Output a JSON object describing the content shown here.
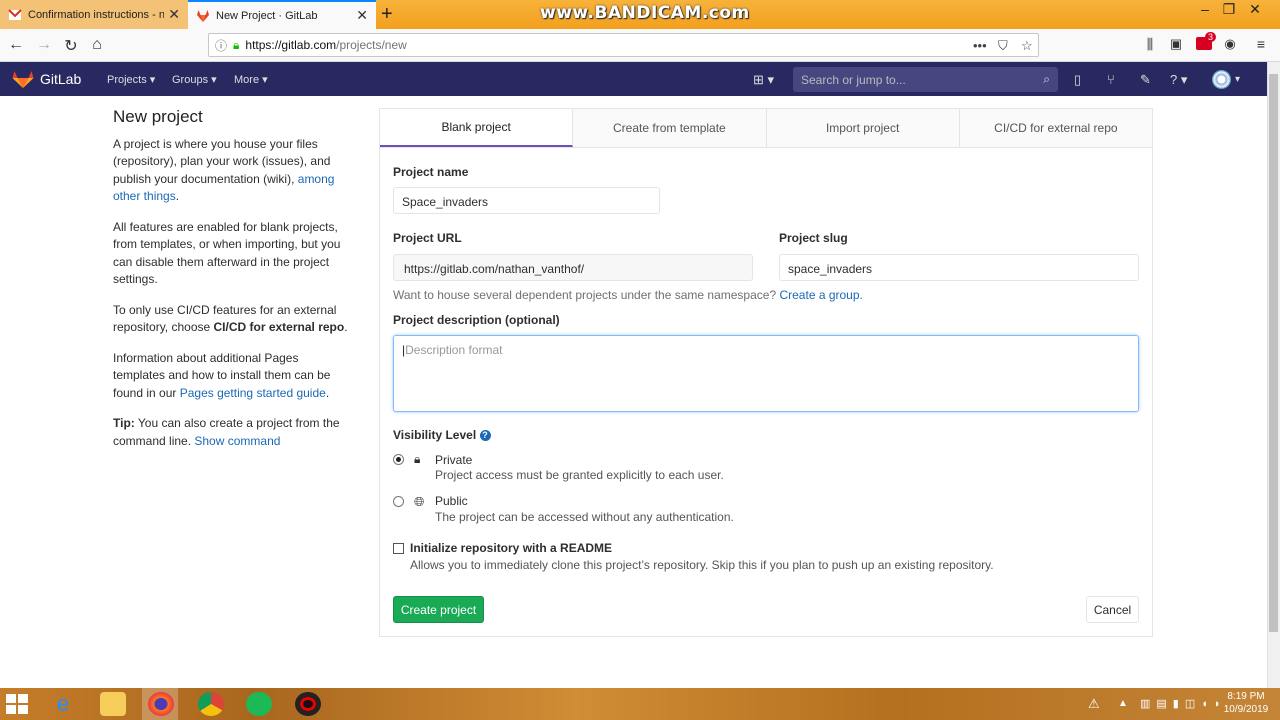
{
  "browser": {
    "tabs": [
      {
        "title": "Confirmation instructions - nat",
        "active": false,
        "icon": "gmail-icon"
      },
      {
        "title": "New Project · GitLab",
        "active": true,
        "icon": "gitlab-icon"
      }
    ],
    "watermark": "www.BANDICAM.com",
    "url_host": "https://gitlab.com",
    "url_path": "/projects/new",
    "badge_count": "3"
  },
  "gitlab_header": {
    "brand": "GitLab",
    "nav": [
      "Projects",
      "Groups",
      "More"
    ],
    "search_placeholder": "Search or jump to..."
  },
  "sidebar": {
    "title": "New project",
    "p1_text": "A project is where you house your files (repository), plan your work (issues), and publish your documentation (wiki), ",
    "p1_link": "among other things",
    "p1_end": ".",
    "p2_text": "All features are enabled for blank projects, from templates, or when importing, but you can disable them afterward in the project settings.",
    "p3_text": "To only use CI/CD features for an external repository, choose ",
    "p3_bold": "CI/CD for external repo",
    "p3_end": ".",
    "p4_text": "Information about additional Pages templates and how to install them can be found in our ",
    "p4_link": "Pages getting started guide",
    "p4_end": ".",
    "tip_label": "Tip:",
    "tip_text": " You can also create a project from the command line. ",
    "tip_link": "Show command"
  },
  "tabs": [
    "Blank project",
    "Create from template",
    "Import project",
    "CI/CD for external repo"
  ],
  "form": {
    "project_name_label": "Project name",
    "project_name_value": "Space_invaders",
    "project_url_label": "Project URL",
    "project_url_value": "https://gitlab.com/nathan_vanthof/",
    "project_slug_label": "Project slug",
    "project_slug_value": "space_invaders",
    "namespace_help": "Want to house several dependent projects under the same namespace? ",
    "create_group_link": "Create a group.",
    "description_label": "Project description (optional)",
    "description_placeholder": "Description format",
    "visibility_label": "Visibility Level",
    "private_label": "Private",
    "private_help": "Project access must be granted explicitly to each user.",
    "public_label": "Public",
    "public_help": "The project can be accessed without any authentication.",
    "readme_label": "Initialize repository with a README",
    "readme_help": "Allows you to immediately clone this project’s repository. Skip this if you plan to push up an existing repository.",
    "create_button": "Create project",
    "cancel_button": "Cancel"
  },
  "taskbar": {
    "time": "8:19 PM",
    "date": "10/9/2019"
  }
}
